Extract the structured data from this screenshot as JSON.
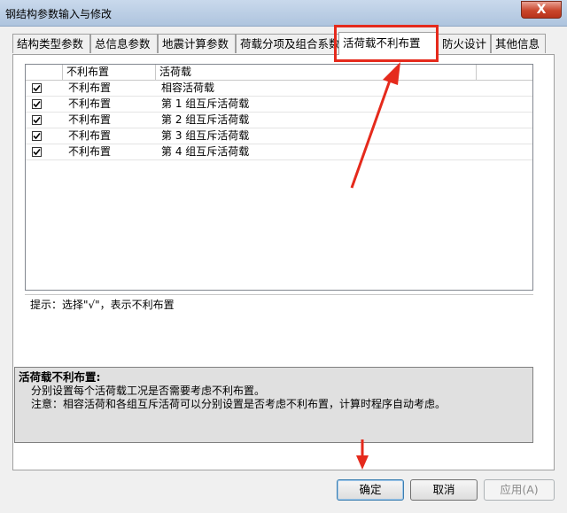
{
  "window": {
    "title": "钢结构参数输入与修改",
    "close_glyph": "X"
  },
  "tabs": [
    {
      "label": "结构类型参数"
    },
    {
      "label": "总信息参数"
    },
    {
      "label": "地震计算参数"
    },
    {
      "label": "荷载分项及组合系数"
    },
    {
      "label": "活荷载不利布置"
    },
    {
      "label": "防火设计"
    },
    {
      "label": "其他信息"
    }
  ],
  "grid": {
    "columns": [
      "不利布置",
      "活荷载"
    ],
    "rows": [
      {
        "checked": true,
        "flag": "不利布置",
        "load": "相容活荷载"
      },
      {
        "checked": true,
        "flag": "不利布置",
        "load": "第 1 组互斥活荷载"
      },
      {
        "checked": true,
        "flag": "不利布置",
        "load": "第 2 组互斥活荷载"
      },
      {
        "checked": true,
        "flag": "不利布置",
        "load": "第 3 组互斥活荷载"
      },
      {
        "checked": true,
        "flag": "不利布置",
        "load": "第 4 组互斥活荷载"
      }
    ]
  },
  "hint": "提示：选择\"√\"，表示不利布置",
  "description": {
    "heading": "活荷载不利布置:",
    "line1": "分别设置每个活荷载工况是否需要考虑不利布置。",
    "line2": "注意：相容活荷和各组互斥活荷可以分别设置是否考虑不利布置，计算时程序自动考虑。"
  },
  "buttons": {
    "ok": "确定",
    "cancel": "取消",
    "apply": "应用(A)"
  },
  "colors": {
    "annotation_red": "#e52a1c"
  }
}
